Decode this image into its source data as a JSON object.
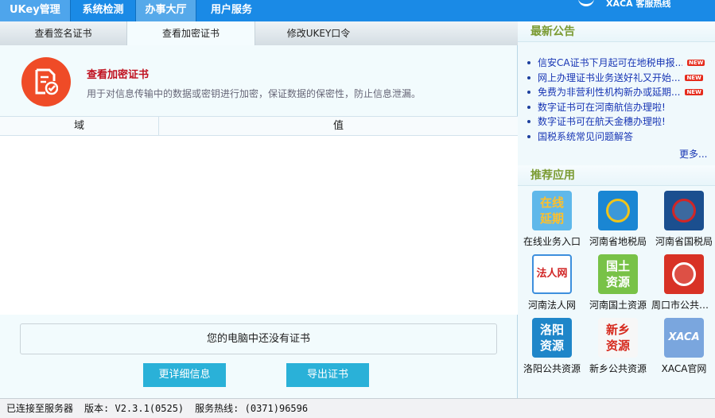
{
  "top_nav": [
    "UKey管理",
    "系统检测",
    "办事大厅",
    "用户服务"
  ],
  "brand": {
    "text": "客服热线"
  },
  "tabs": [
    "查看签名证书",
    "查看加密证书",
    "修改UKEY口令"
  ],
  "cert": {
    "title": "查看加密证书",
    "description": "用于对信息传输中的数据或密钥进行加密，保证数据的保密性，防止信息泄漏。"
  },
  "table": {
    "headers": [
      "域",
      "值"
    ],
    "rows": []
  },
  "message": "您的电脑中还没有证书",
  "buttons": {
    "details": "更详细信息",
    "export": "导出证书"
  },
  "announcements": {
    "title": "最新公告",
    "items": [
      {
        "text": "信安CA证书下月起可在地税申报...",
        "badge": "NEW"
      },
      {
        "text": "网上办理证书业务送好礼又开始...",
        "badge": "NEW"
      },
      {
        "text": "免费为非营利性机构新办或延期...",
        "badge": "NEW"
      },
      {
        "text": "数字证书可在河南航信办理啦!",
        "badge": ""
      },
      {
        "text": "数字证书可在航天金穗办理啦!",
        "badge": ""
      },
      {
        "text": "国税系统常见问题解答",
        "badge": ""
      }
    ],
    "more": "更多..."
  },
  "apps": {
    "title": "推荐应用",
    "items": [
      {
        "label": "在线业务入口",
        "icon_text": "在线\n延期",
        "icon": "online-renew-icon",
        "color": "#ffc02a",
        "bg": "#5fb8ea"
      },
      {
        "label": "河南省地税局",
        "icon_text": "",
        "icon": "local-tax-emblem-icon",
        "color": "#f0c419",
        "bg": "#1a86d3"
      },
      {
        "label": "河南省国税局",
        "icon_text": "",
        "icon": "national-tax-emblem-icon",
        "color": "#d12626",
        "bg": "#1b4f8f"
      },
      {
        "label": "河南法人网",
        "icon_text": "法人网",
        "icon": "legal-person-icon",
        "color": "#d12626",
        "bg": "#3d8fdd"
      },
      {
        "label": "河南国土资源",
        "icon_text": "国土\n资源",
        "icon": "land-resources-icon",
        "color": "#ffffff",
        "bg": "#78c247"
      },
      {
        "label": "周口市公共资源",
        "icon_text": "",
        "icon": "zhoukou-resource-icon",
        "color": "#ffffff",
        "bg": "#d83225"
      },
      {
        "label": "洛阳公共资源",
        "icon_text": "洛阳\n资源",
        "icon": "luoyang-resource-icon",
        "color": "#ffffff",
        "bg": "#1f86c9"
      },
      {
        "label": "新乡公共资源",
        "icon_text": "新乡\n资源",
        "icon": "xinxiang-resource-icon",
        "color": "#d62a1e",
        "bg": "#f7f7f7"
      },
      {
        "label": "XACA官网",
        "icon_text": "XACA",
        "icon": "xaca-logo-icon",
        "color": "#ffffff",
        "bg": "#7aa6de"
      }
    ]
  },
  "status": {
    "connection": "已连接至服务器",
    "version": "版本: V2.3.1(0525)",
    "hotline": "服务热线: (0371)96596"
  }
}
